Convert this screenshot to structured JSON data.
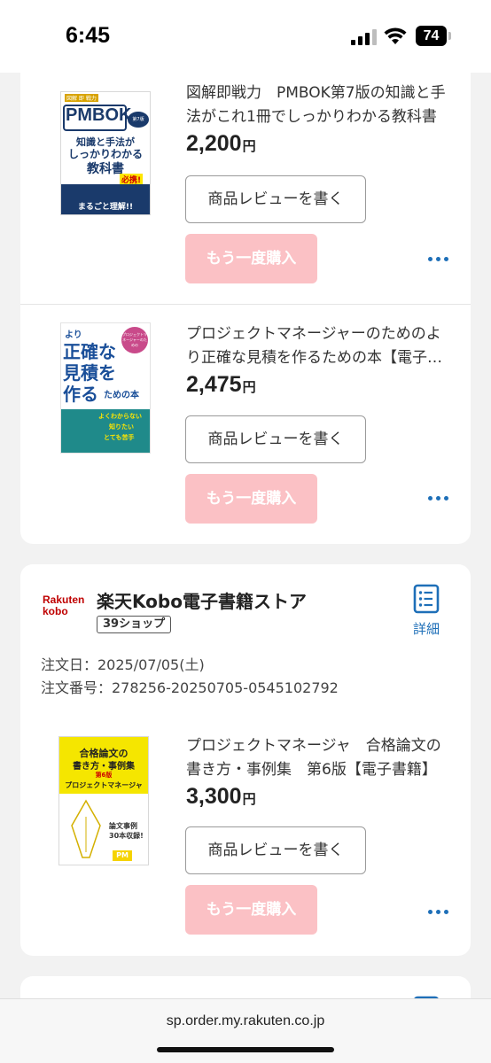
{
  "status_bar": {
    "time": "6:45",
    "battery": "74"
  },
  "items": [
    {
      "title": "図解即戦力　PMBOK第7版の知識と手法がこれ1冊でしっかりわかる教科書",
      "price": "2,200",
      "currency": "円",
      "review_label": "商品レビューを書く",
      "rebuy_label": "もう一度購入",
      "cover": {
        "series": "図解 即 戦力",
        "brand": "PMBOK",
        "edition": "第7版",
        "line1": "知識と手法が",
        "line2": "しっかりわかる",
        "line3": "教科書",
        "tag": "必携!",
        "tagline": "まるごと理解!!"
      }
    },
    {
      "title": "プロジェクトマネージャーのためのより正確な見積を作るための本【電子書籍】",
      "price": "2,475",
      "currency": "円",
      "review_label": "商品レビューを書く",
      "rebuy_label": "もう一度購入",
      "cover": {
        "line1": "より",
        "line2": "正確な",
        "line3": "見積を",
        "line4": "作る",
        "line5": "ための本",
        "badge": "プロジェクトマネージャーのための",
        "point1": "よくわからない",
        "point2": "知りたい",
        "point3": "とても苦手"
      }
    }
  ],
  "shop": {
    "logo_line1": "Rakuten",
    "logo_line2": "kobo",
    "name": "楽天Kobo電子書籍ストア",
    "badge": "39ショップ",
    "detail_label": "詳細",
    "order_date": "注文日：2025/07/05(土)",
    "order_number": "注文番号：278256-20250705-0545102792"
  },
  "shop_item": {
    "title": "プロジェクトマネージャ　合格論文の書き方・事例集　第6版【電子書籍】",
    "price": "3,300",
    "currency": "円",
    "review_label": "商品レビューを書く",
    "rebuy_label": "もう一度購入",
    "cover": {
      "line1": "合格論文の",
      "line2": "書き方・事例集",
      "edition": "第6版",
      "line3": "プロジェクトマネージャ",
      "note1": "論文事例",
      "note2": "30本収録!",
      "mark": "PM"
    }
  },
  "url_bar": {
    "url": "sp.order.my.rakuten.co.jp"
  },
  "colors": {
    "accent_blue": "#1e6fb8",
    "rebuy_pink": "#fbc1c5",
    "rakuten_red": "#bf0000"
  }
}
